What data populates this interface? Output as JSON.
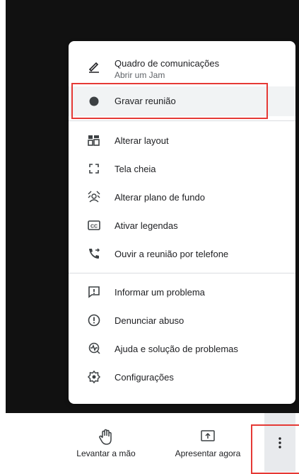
{
  "menu": {
    "items": [
      {
        "label": "Quadro de comunicações",
        "sublabel": "Abrir um Jam",
        "icon": "pen-icon"
      },
      {
        "label": "Gravar reunião",
        "icon": "record-dot-icon"
      },
      {
        "label": "Alterar layout",
        "icon": "layout-icon"
      },
      {
        "label": "Tela cheia",
        "icon": "fullscreen-icon"
      },
      {
        "label": "Alterar plano de fundo",
        "icon": "background-icon"
      },
      {
        "label": "Ativar legendas",
        "icon": "captions-icon"
      },
      {
        "label": "Ouvir a reunião por telefone",
        "icon": "phone-forward-icon"
      },
      {
        "label": "Informar um problema",
        "icon": "feedback-icon"
      },
      {
        "label": "Denunciar abuso",
        "icon": "report-icon"
      },
      {
        "label": "Ajuda e solução de problemas",
        "icon": "help-troubleshoot-icon"
      },
      {
        "label": "Configurações",
        "icon": "settings-icon"
      }
    ]
  },
  "toolbar": {
    "raise_hand_label": "Levantar a mão",
    "present_label": "Apresentar agora"
  },
  "colors": {
    "highlight_box": "#e53935",
    "meeting_background": "#111111",
    "menu_hover": "#f1f3f4"
  }
}
